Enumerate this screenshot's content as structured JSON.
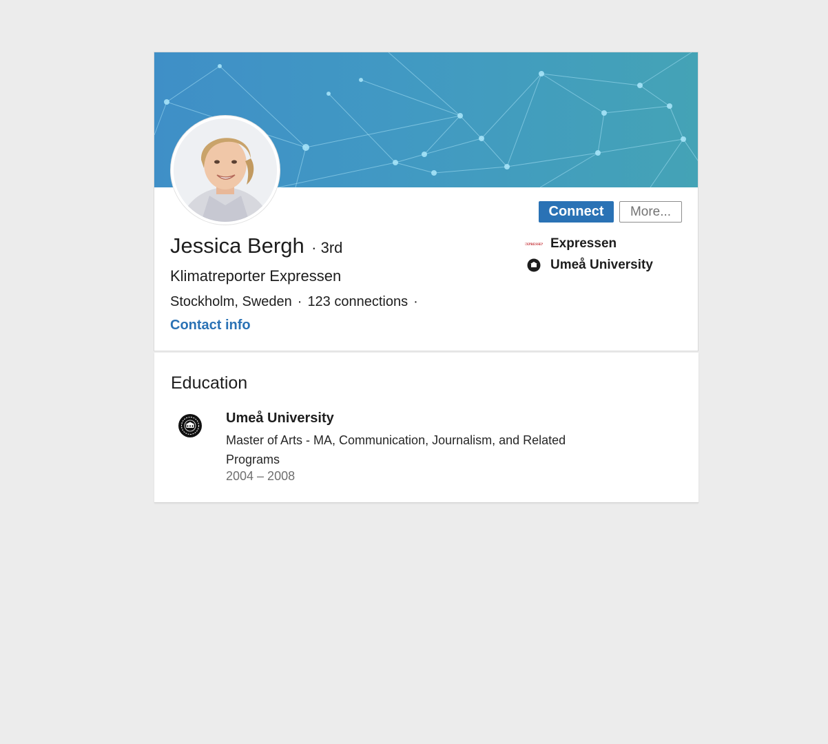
{
  "profile": {
    "name": "Jessica Bergh",
    "degree": "· 3rd",
    "headline": "Klimatreporter Expressen",
    "location": "Stockholm, Sweden",
    "connections": "123 connections",
    "contact_info": "Contact info"
  },
  "actions": {
    "connect_label": "Connect",
    "more_label": "More..."
  },
  "sidebar": {
    "items": [
      {
        "label": "Expressen",
        "logo": "expressen-logo"
      },
      {
        "label": "Umeå University",
        "logo": "umea-university-logo"
      }
    ]
  },
  "education": {
    "title": "Education",
    "entries": [
      {
        "school": "Umeå University",
        "degree": "Master of Arts - MA, Communication, Journalism, and Related Programs",
        "years": "2004 – 2008",
        "logo": "umea-university-logo"
      }
    ]
  },
  "colors": {
    "accent": "#2a72b5",
    "banner_start": "#3f8fc7",
    "banner_end": "#44a3b6",
    "page_bg": "#ececec"
  }
}
